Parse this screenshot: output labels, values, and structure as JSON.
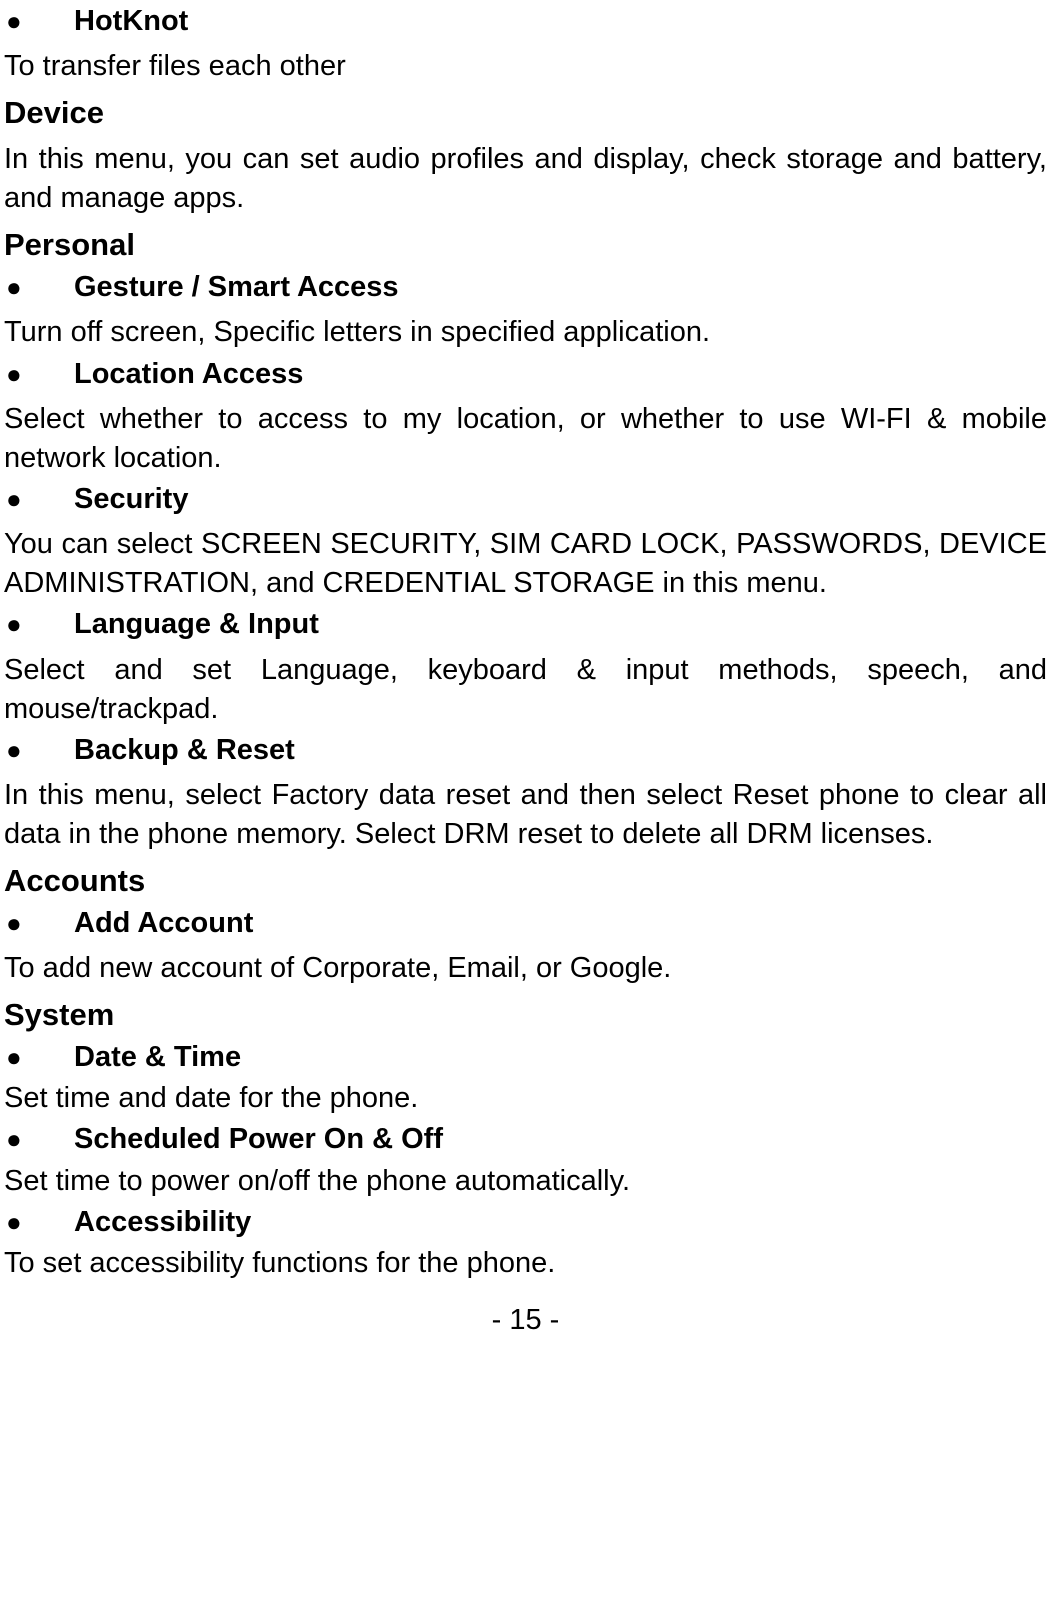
{
  "items": {
    "hotknot": {
      "label": "HotKnot",
      "text": "To transfer files each other"
    },
    "device": {
      "head": "Device",
      "text": "In this menu, you can set audio profiles and display, check storage and battery, and manage apps."
    },
    "personal": {
      "head": "Personal"
    },
    "gesture": {
      "label": "Gesture / Smart Access",
      "text": "Turn off screen, Specific letters in specified application."
    },
    "location": {
      "label": "Location Access",
      "text": "Select whether to access to my location, or whether to use WI-FI  & mobile network location."
    },
    "security": {
      "label": "Security",
      "text": "You can select SCREEN SECURITY, SIM CARD LOCK, PASSWORDS, DEVICE ADMINISTRATION, and CREDENTIAL STORAGE in this menu."
    },
    "language": {
      "label": "Language & Input",
      "text": "Select and set Language, keyboard & input methods, speech, and mouse/trackpad."
    },
    "backup": {
      "label": "Backup & Reset",
      "text": "In this menu, select Factory data reset and then select Reset phone to clear all data in the phone memory. Select DRM reset to delete all DRM licenses."
    },
    "accounts": {
      "head": "Accounts"
    },
    "addaccount": {
      "label": "Add Account",
      "text": "To add new account of Corporate, Email, or Google."
    },
    "system": {
      "head": "System"
    },
    "datetime": {
      "label": "Date & Time",
      "text": "Set time and date for the phone."
    },
    "scheduled": {
      "label": "Scheduled Power On & Off",
      "text": "Set time to power on/off the phone automatically."
    },
    "accessibility": {
      "label": "Accessibility",
      "text": "To set accessibility functions for the phone."
    }
  },
  "footer": "- 15 -"
}
